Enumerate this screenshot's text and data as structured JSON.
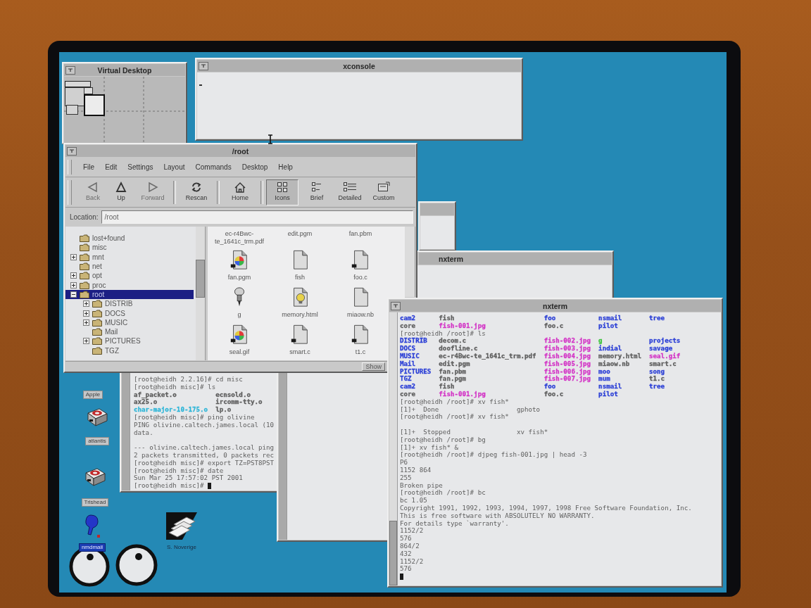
{
  "pager": {
    "title": "Virtual Desktop"
  },
  "console": {
    "title": "xconsole"
  },
  "file_manager": {
    "title": "/root",
    "menu": [
      "File",
      "Edit",
      "Settings",
      "Layout",
      "Commands",
      "Desktop",
      "Help"
    ],
    "nav_buttons": [
      {
        "label": "Back",
        "kind": "back",
        "disabled": true
      },
      {
        "label": "Up",
        "kind": "up",
        "disabled": false
      },
      {
        "label": "Forward",
        "kind": "forward",
        "disabled": true
      },
      {
        "label": "Rescan",
        "kind": "rescan",
        "disabled": false
      },
      {
        "label": "Home",
        "kind": "home",
        "disabled": false
      }
    ],
    "view_buttons": [
      {
        "label": "Icons",
        "kind": "icons",
        "selected": true
      },
      {
        "label": "Brief",
        "kind": "brief",
        "selected": false
      },
      {
        "label": "Detailed",
        "kind": "detailed",
        "selected": false
      },
      {
        "label": "Custom",
        "kind": "custom",
        "selected": false
      }
    ],
    "location": {
      "label": "Location:",
      "value": "/root"
    },
    "tree": [
      {
        "label": "lost+found",
        "selected": false
      },
      {
        "label": "misc",
        "selected": false
      },
      {
        "label": "mnt",
        "expanded": false,
        "selected": false
      },
      {
        "label": "net",
        "selected": false
      },
      {
        "label": "opt",
        "expanded": false,
        "selected": false
      },
      {
        "label": "proc",
        "expanded": false,
        "selected": false
      },
      {
        "label": "root",
        "expanded": true,
        "selected": true,
        "children": [
          {
            "label": "DISTRIB",
            "expanded": false,
            "selected": false
          },
          {
            "label": "DOCS",
            "expanded": false,
            "selected": false
          },
          {
            "label": "MUSIC",
            "expanded": false,
            "selected": false
          },
          {
            "label": "Mail",
            "selected": false
          },
          {
            "label": "PICTURES",
            "expanded": false,
            "selected": false
          },
          {
            "label": "TGZ",
            "selected": false
          }
        ]
      }
    ],
    "icon_view": {
      "partial_row": [
        "ec-r4Bwc-te_1641c_trm.pdf",
        "edit.pgm",
        "fan.pbm"
      ],
      "files": [
        {
          "name": "fan.pgm",
          "kind": "image"
        },
        {
          "name": "fish",
          "kind": "document"
        },
        {
          "name": "foo.c",
          "kind": "source"
        },
        {
          "name": "g",
          "kind": "tool"
        },
        {
          "name": "memory.html",
          "kind": "web"
        },
        {
          "name": "miaow.nb",
          "kind": "document"
        },
        {
          "name": "seal.gif",
          "kind": "image"
        },
        {
          "name": "smart.c",
          "kind": "source"
        },
        {
          "name": "t1.c",
          "kind": "source"
        }
      ]
    },
    "status_button": "Show"
  },
  "middle_terminal": {
    "title": "nxterm"
  },
  "main_terminal": {
    "title": "nxterm",
    "lines": [
      {
        "kind": "columns",
        "cells": [
          {
            "text": "cam2",
            "color": "#2b3fd6"
          },
          {
            "text": "fish",
            "color": "#5f5f5f"
          },
          {
            "text": "foo",
            "color": "#2b3fd6"
          },
          {
            "text": "nsmail",
            "color": "#2b3fd6"
          },
          {
            "text": "tree",
            "color": "#2b3fd6"
          }
        ]
      },
      {
        "kind": "columns",
        "cells": [
          {
            "text": "core",
            "color": "#5f5f5f"
          },
          {
            "text": "fish-001.jpg",
            "color": "#d335c6"
          },
          {
            "text": "foo.c",
            "color": "#5f5f5f"
          },
          {
            "text": "pilot",
            "color": "#2b3fd6"
          }
        ]
      },
      {
        "kind": "text",
        "text": "[root@heidh /root]# ls"
      },
      {
        "kind": "columns",
        "cells": [
          {
            "text": "DISTRIB",
            "color": "#2b3fd6"
          },
          {
            "text": "decom.c",
            "color": "#5f5f5f"
          },
          {
            "text": "fish-002.jpg",
            "color": "#d335c6"
          },
          {
            "text": "g",
            "color": "#36c236"
          },
          {
            "text": "projects",
            "color": "#2b3fd6"
          }
        ]
      },
      {
        "kind": "columns",
        "cells": [
          {
            "text": "DOCS",
            "color": "#2b3fd6"
          },
          {
            "text": "doofline.c",
            "color": "#5f5f5f"
          },
          {
            "text": "fish-003.jpg",
            "color": "#d335c6"
          },
          {
            "text": "indial",
            "color": "#2b3fd6"
          },
          {
            "text": "savage",
            "color": "#2b3fd6"
          }
        ]
      },
      {
        "kind": "columns",
        "cells": [
          {
            "text": "MUSIC",
            "color": "#2b3fd6"
          },
          {
            "text": "ec-r4Bwc-te_1641c_trm.pdf",
            "color": "#5f5f5f"
          },
          {
            "text": "fish-004.jpg",
            "color": "#d335c6"
          },
          {
            "text": "memory.html",
            "color": "#5f5f5f"
          },
          {
            "text": "seal.gif",
            "color": "#d335c6"
          }
        ]
      },
      {
        "kind": "columns",
        "cells": [
          {
            "text": "Mail",
            "color": "#2b3fd6"
          },
          {
            "text": "edit.pgm",
            "color": "#5f5f5f"
          },
          {
            "text": "fish-005.jpg",
            "color": "#d335c6"
          },
          {
            "text": "miaow.nb",
            "color": "#5f5f5f"
          },
          {
            "text": "smart.c",
            "color": "#5f5f5f"
          }
        ]
      },
      {
        "kind": "columns",
        "cells": [
          {
            "text": "PICTURES",
            "color": "#2b3fd6"
          },
          {
            "text": "fan.pbm",
            "color": "#5f5f5f"
          },
          {
            "text": "fish-006.jpg",
            "color": "#d335c6"
          },
          {
            "text": "moo",
            "color": "#2b3fd6"
          },
          {
            "text": "song",
            "color": "#2b3fd6"
          }
        ]
      },
      {
        "kind": "columns",
        "cells": [
          {
            "text": "TGZ",
            "color": "#2b3fd6"
          },
          {
            "text": "fan.pgm",
            "color": "#5f5f5f"
          },
          {
            "text": "fish-007.jpg",
            "color": "#d335c6"
          },
          {
            "text": "mum",
            "color": "#2b3fd6"
          },
          {
            "text": "t1.c",
            "color": "#5f5f5f"
          }
        ]
      },
      {
        "kind": "columns",
        "cells": [
          {
            "text": "cam2",
            "color": "#2b3fd6"
          },
          {
            "text": "fish",
            "color": "#5f5f5f"
          },
          {
            "text": "foo",
            "color": "#2b3fd6"
          },
          {
            "text": "nsmail",
            "color": "#2b3fd6"
          },
          {
            "text": "tree",
            "color": "#2b3fd6"
          }
        ]
      },
      {
        "kind": "columns",
        "cells": [
          {
            "text": "core",
            "color": "#5f5f5f"
          },
          {
            "text": "fish-001.jpg",
            "color": "#d335c6"
          },
          {
            "text": "foo.c",
            "color": "#5f5f5f"
          },
          {
            "text": "pilot",
            "color": "#2b3fd6"
          }
        ]
      },
      {
        "kind": "text",
        "text": "[root@heidh /root]# xv fish*"
      },
      {
        "kind": "text",
        "text": "[1]+  Done                    gphoto"
      },
      {
        "kind": "text",
        "text": "[root@heidh /root]# xv fish*"
      },
      {
        "kind": "blank"
      },
      {
        "kind": "text",
        "text": "[1]+  Stopped                 xv fish*"
      },
      {
        "kind": "text",
        "text": "[root@heidh /root]# bg"
      },
      {
        "kind": "text",
        "text": "[1]+ xv fish* &"
      },
      {
        "kind": "text",
        "text": "[root@heidh /root]# djpeg fish-001.jpg | head -3"
      },
      {
        "kind": "text",
        "text": "P6"
      },
      {
        "kind": "text",
        "text": "1152 864"
      },
      {
        "kind": "text",
        "text": "255"
      },
      {
        "kind": "text",
        "text": "Broken pipe"
      },
      {
        "kind": "text",
        "text": "[root@heidh /root]# bc"
      },
      {
        "kind": "text",
        "text": "bc 1.05"
      },
      {
        "kind": "text",
        "text": "Copyright 1991, 1992, 1993, 1994, 1997, 1998 Free Software Foundation, Inc."
      },
      {
        "kind": "text",
        "text": "This is free software with ABSOLUTELY NO WARRANTY."
      },
      {
        "kind": "text",
        "text": "For details type `warranty'."
      },
      {
        "kind": "text",
        "text": "1152/2"
      },
      {
        "kind": "text",
        "text": "576"
      },
      {
        "kind": "text",
        "text": "864/2"
      },
      {
        "kind": "text",
        "text": "432"
      },
      {
        "kind": "text",
        "text": "1152/2"
      },
      {
        "kind": "text",
        "text": "576"
      },
      {
        "kind": "cursor"
      }
    ]
  },
  "left_terminal": {
    "lines": [
      {
        "kind": "text",
        "text": "[root@heidh 2.2.16]# cd misc"
      },
      {
        "kind": "text",
        "text": "[root@heidh misc]# ls"
      },
      {
        "kind": "columns",
        "cells": [
          {
            "text": "af_packet.o",
            "color": "#5f5f5f"
          },
          {
            "text": "ecnsold.o",
            "color": "#5f5f5f"
          }
        ]
      },
      {
        "kind": "columns",
        "cells": [
          {
            "text": "ax25.o",
            "color": "#5f5f5f"
          },
          {
            "text": "ircomm-tty.o",
            "color": "#5f5f5f"
          }
        ]
      },
      {
        "kind": "columns",
        "cells": [
          {
            "text": "char-major-10-175.o",
            "color": "#2fb6d8"
          },
          {
            "text": "lp.o",
            "color": "#5f5f5f"
          }
        ]
      },
      {
        "kind": "text",
        "text": "[root@heidh misc]# ping olivine"
      },
      {
        "kind": "text",
        "text": "PING olivine.caltech.james.local (10"
      },
      {
        "kind": "text",
        "text": "data."
      },
      {
        "kind": "blank"
      },
      {
        "kind": "text",
        "text": "--- olivine.caltech.james.local ping"
      },
      {
        "kind": "text",
        "text": "2 packets transmitted, 0 packets rec"
      },
      {
        "kind": "text",
        "text": "[root@heidh misc]# export TZ=PST8PST"
      },
      {
        "kind": "text",
        "text": "[root@heidh misc]# date"
      },
      {
        "kind": "text",
        "text": "Sun Mar 25 17:57:02 PST 2001"
      },
      {
        "kind": "prompt",
        "text": "[root@heidh misc]# "
      }
    ]
  },
  "desktop": {
    "icons": [
      {
        "label": "Apple",
        "selected": false
      },
      {
        "label": "atlantis",
        "kind": "disk",
        "selected": false
      },
      {
        "label": "Trishead",
        "kind": "disk",
        "selected": false
      },
      {
        "label": "nmdmail",
        "kind": "pen",
        "selected": true
      },
      {
        "label": "S. Noverige",
        "kind": "papers",
        "selected": false
      }
    ]
  }
}
